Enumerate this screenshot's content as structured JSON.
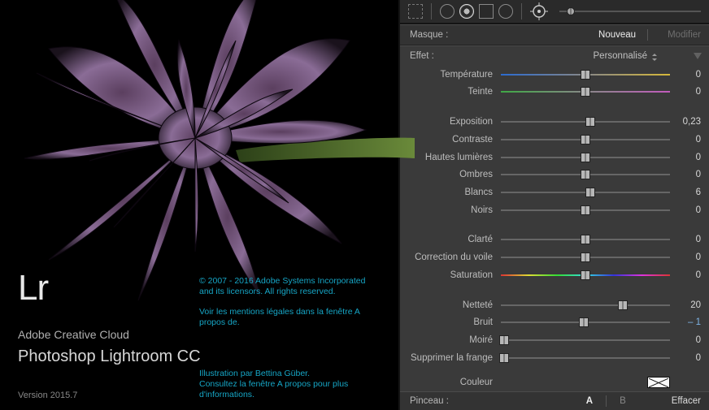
{
  "splash": {
    "logo": "Lr",
    "creativeCloud": "Adobe Creative Cloud",
    "product": "Photoshop Lightroom CC",
    "version": "Version 2015.7",
    "copyright": "© 2007 - 2016 Adobe Systems Incorporated and its licensors. All rights reserved.",
    "legal": "Voir les mentions légales dans la fenêtre A propos de.",
    "illustration": "Illustration par Bettina Güber.\nConsultez la fenêtre A propos pour plus d'informations."
  },
  "panel": {
    "mask": {
      "label": "Masque :",
      "new": "Nouveau",
      "modify": "Modifier"
    },
    "effect": {
      "label": "Effet :",
      "preset": "Personnalisé"
    },
    "wb": {
      "temperature": {
        "label": "Température",
        "value": "0",
        "pos": 50
      },
      "tint": {
        "label": "Teinte",
        "value": "0",
        "pos": 50
      }
    },
    "tone": {
      "exposure": {
        "label": "Exposition",
        "value": "0,23",
        "pos": 53
      },
      "contrast": {
        "label": "Contraste",
        "value": "0",
        "pos": 50
      },
      "highlights": {
        "label": "Hautes lumières",
        "value": "0",
        "pos": 50
      },
      "shadows": {
        "label": "Ombres",
        "value": "0",
        "pos": 50
      },
      "whites": {
        "label": "Blancs",
        "value": "6",
        "pos": 53
      },
      "blacks": {
        "label": "Noirs",
        "value": "0",
        "pos": 50
      }
    },
    "presence": {
      "clarity": {
        "label": "Clarté",
        "value": "0",
        "pos": 50
      },
      "dehaze": {
        "label": "Correction du voile",
        "value": "0",
        "pos": 50
      },
      "saturation": {
        "label": "Saturation",
        "value": "0",
        "pos": 50
      }
    },
    "detail": {
      "sharpness": {
        "label": "Netteté",
        "value": "20",
        "pos": 72
      },
      "noise": {
        "label": "Bruit",
        "value": "– 1",
        "pos": 49
      },
      "moire": {
        "label": "Moiré",
        "value": "0",
        "pos": 2
      },
      "defringe": {
        "label": "Supprimer la frange",
        "value": "0",
        "pos": 2
      }
    },
    "color": {
      "label": "Couleur"
    },
    "brush": {
      "label": "Pinceau :",
      "A": "A",
      "B": "B",
      "erase": "Effacer"
    }
  }
}
